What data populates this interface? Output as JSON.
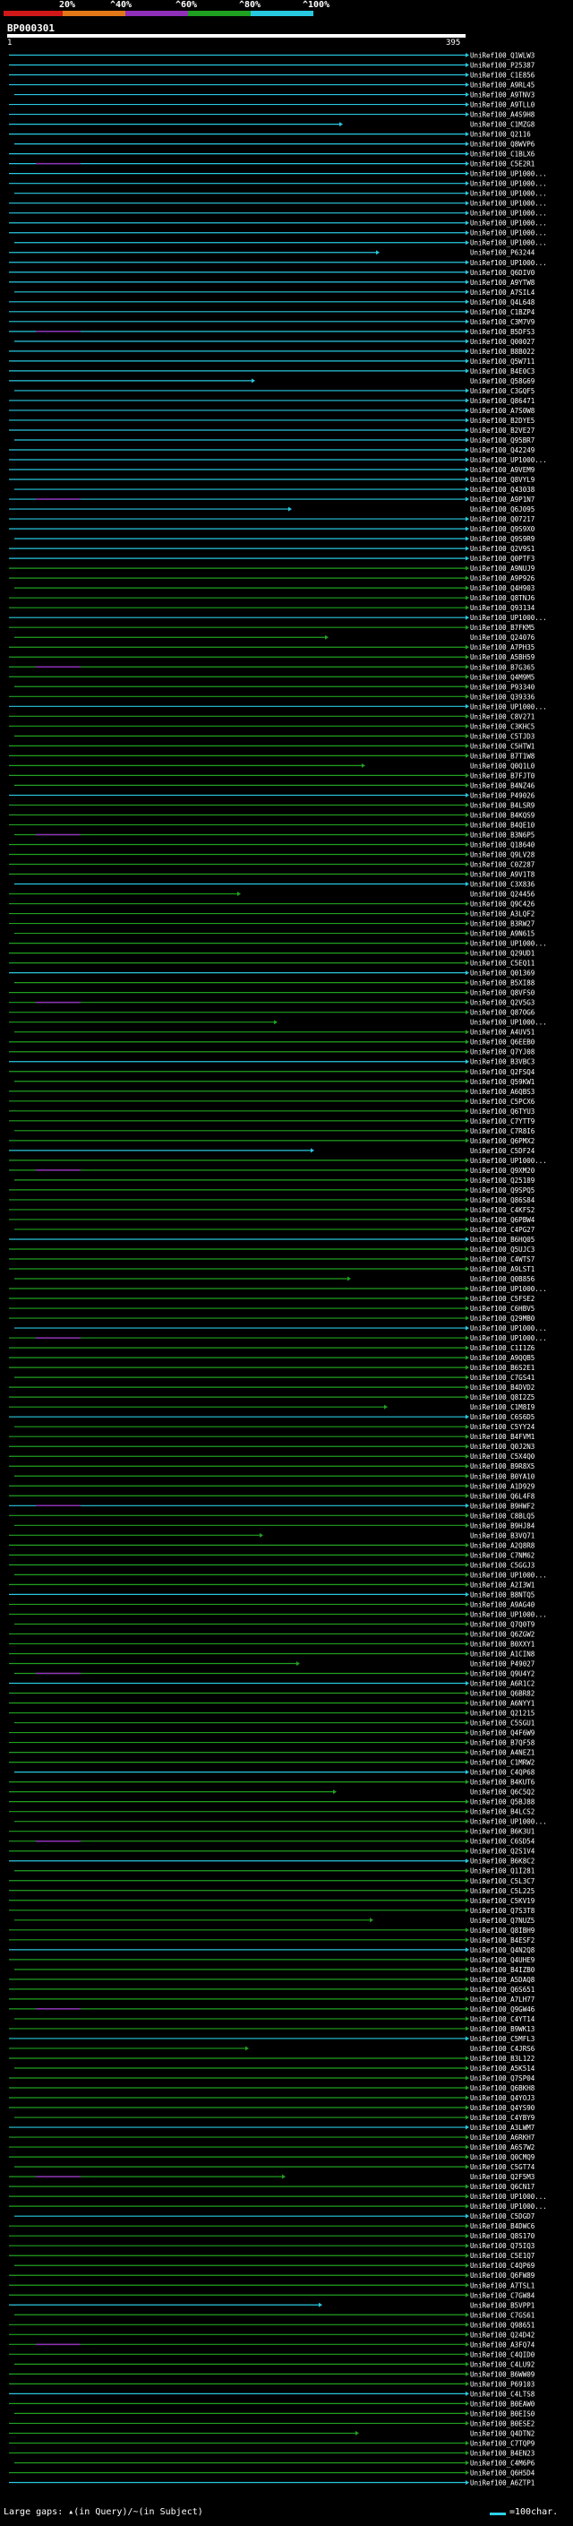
{
  "legend": {
    "labels": [
      "20%",
      "^40%",
      "^60%",
      "^80%",
      "^100%"
    ],
    "colors": [
      "#d01818",
      "#e07818",
      "#9030b8",
      "#20a020",
      "#28c8e0"
    ]
  },
  "query_id": "BP000301",
  "ruler": {
    "start": "1",
    "end": "395"
  },
  "hits": [
    "UniRef100_Q1WLW3",
    "UniRef100_P25387",
    "UniRef100_C1E856",
    "UniRef100_A9RL45",
    "UniRef100_A9TNV3",
    "UniRef100_A9TLL0",
    "UniRef100_A4S9H8",
    "UniRef100_C1MZG8",
    "UniRef100_Q2116",
    "UniRef100_Q8WVP6",
    "UniRef100_C1BLX6",
    "UniRef100_C5E2R1",
    "UniRef100_UP1000...",
    "UniRef100_UP1000...",
    "UniRef100_UP1000...",
    "UniRef100_UP1000...",
    "UniRef100_UP1000...",
    "UniRef100_UP1000...",
    "UniRef100_UP1000...",
    "UniRef100_UP1000...",
    "UniRef100_P63244",
    "UniRef100_UP1000...",
    "UniRef100_Q6DIV0",
    "UniRef100_A9YTW8",
    "UniRef100_A7SIL4",
    "UniRef100_Q4L648",
    "UniRef100_C1BZP4",
    "UniRef100_C3M7V9",
    "UniRef100_B5DFS3",
    "UniRef100_Q00027",
    "UniRef100_B8B022",
    "UniRef100_Q5W711",
    "UniRef100_B4E0C3",
    "UniRef100_Q58G69",
    "UniRef100_C3GQF5",
    "UniRef100_Q86471",
    "UniRef100_A7S0W8",
    "UniRef100_B2DYE5",
    "UniRef100_B2VE27",
    "UniRef100_Q95BR7",
    "UniRef100_Q42249",
    "UniRef100_UP1000...",
    "UniRef100_A9VEM9",
    "UniRef100_Q8VYL9",
    "UniRef100_Q43038",
    "UniRef100_A9P1N7",
    "UniRef100_Q6J095",
    "UniRef100_Q07217",
    "UniRef100_Q9S9X0",
    "UniRef100_Q9S9R9",
    "UniRef100_Q2V9S1",
    "UniRef100_Q0PTF3",
    "UniRef100_A9NUJ9",
    "UniRef100_A9P926",
    "UniRef100_Q4H903",
    "UniRef100_Q8TNJ6",
    "UniRef100_Q93134",
    "UniRef100_UP1000...",
    "UniRef100_B7FKM5",
    "UniRef100_Q24076",
    "UniRef100_A7PH35",
    "UniRef100_A5BH59",
    "UniRef100_B7G365",
    "UniRef100_Q4M9M5",
    "UniRef100_P93340",
    "UniRef100_Q39336",
    "UniRef100_UP1000...",
    "UniRef100_C8V271",
    "UniRef100_C3KHC5",
    "UniRef100_C5TJD3",
    "UniRef100_C5HTW1",
    "UniRef100_B7T1W8",
    "UniRef100_Q0Q1L0",
    "UniRef100_B7FJT0",
    "UniRef100_B4NZ46",
    "UniRef100_P49026",
    "UniRef100_B4LSR9",
    "UniRef100_B4KQS9",
    "UniRef100_B4QE10",
    "UniRef100_B3N6P5",
    "UniRef100_Q18640",
    "UniRef100_Q9LV28",
    "UniRef100_C0Z287",
    "UniRef100_A9V1T8",
    "UniRef100_C3X836",
    "UniRef100_Q24456",
    "UniRef100_Q9C426",
    "UniRef100_A3LQF2",
    "UniRef100_B3RW27",
    "UniRef100_A9N615",
    "UniRef100_UP1000...",
    "UniRef100_Q29UD1",
    "UniRef100_C5EQ11",
    "UniRef100_Q01369",
    "UniRef100_B5XI88",
    "UniRef100_Q8VFS0",
    "UniRef100_Q2V5G3",
    "UniRef100_Q87OG6",
    "UniRef100_UP1000...",
    "UniRef100_A4UV51",
    "UniRef100_Q6EEB0",
    "UniRef100_Q7YJ08",
    "UniRef100_B3VBC3",
    "UniRef100_Q2FSQ4",
    "UniRef100_Q59KW1",
    "UniRef100_A6QBS3",
    "UniRef100_C5PCX6",
    "UniRef100_Q6TYU3",
    "UniRef100_C7YTT9",
    "UniRef100_C7R8I6",
    "UniRef100_Q6PMX2",
    "UniRef100_C5DF24",
    "UniRef100_UP1000...",
    "UniRef100_Q9XM20",
    "UniRef100_Q25189",
    "UniRef100_Q9SPQ5",
    "UniRef100_Q86S84",
    "UniRef100_C4KFS2",
    "UniRef100_Q6PBW4",
    "UniRef100_C4PG27",
    "UniRef100_B6HQ05",
    "UniRef100_Q5UJC3",
    "UniRef100_C4WTS7",
    "UniRef100_A9LST1",
    "UniRef100_Q0B856",
    "UniRef100_UP1000...",
    "UniRef100_C5FSE2",
    "UniRef100_C6HBV5",
    "UniRef100_Q29MB0",
    "UniRef100_UP1000...",
    "UniRef100_UP1000...",
    "UniRef100_C1I1Z6",
    "UniRef100_A9QQB5",
    "UniRef100_B6S2E1",
    "UniRef100_C7GS41",
    "UniRef100_B4DVD2",
    "UniRef100_Q8I2Z5",
    "UniRef100_C1M8I9",
    "UniRef100_C6S6D5",
    "UniRef100_C5YY24",
    "UniRef100_B4FVM1",
    "UniRef100_Q0J2N3",
    "UniRef100_C5X4Q0",
    "UniRef100_B9R8X5",
    "UniRef100_B0YA10",
    "UniRef100_A1D929",
    "UniRef100_Q6L4F8",
    "UniRef100_B9HWF2",
    "UniRef100_C8BLQ5",
    "UniRef100_B9HJ84",
    "UniRef100_B3VQ71",
    "UniRef100_A2Q8R8",
    "UniRef100_C7NM62",
    "UniRef100_C5GGJ3",
    "UniRef100_UP1000...",
    "UniRef100_A2I3W1",
    "UniRef100_B8NTQ5",
    "UniRef100_A9AG40",
    "UniRef100_UP1000...",
    "UniRef100_Q7Q0T9",
    "UniRef100_Q6ZGW2",
    "UniRef100_B0XXY1",
    "UniRef100_A1CIN8",
    "UniRef100_P49027",
    "UniRef100_Q9U4Y2",
    "UniRef100_A6R1C2",
    "UniRef100_Q6BR82",
    "UniRef100_A6NYY1",
    "UniRef100_Q21215",
    "UniRef100_C5SGU1",
    "UniRef100_Q4F6W9",
    "UniRef100_B7QF58",
    "UniRef100_A4NEZ1",
    "UniRef100_C1MRW2",
    "UniRef100_C4QP68",
    "UniRef100_B4KUT6",
    "UniRef100_Q6C5Q2",
    "UniRef100_Q5BJ88",
    "UniRef100_B4LCS2",
    "UniRef100_UP1000...",
    "UniRef100_B6K3U1",
    "UniRef100_C6SD54",
    "UniRef100_Q2S1V4",
    "UniRef100_B6K8C2",
    "UniRef100_Q1I281",
    "UniRef100_C5L3C7",
    "UniRef100_C5L225",
    "UniRef100_C5KV19",
    "UniRef100_Q7S3T8",
    "UniRef100_Q7NUZ5",
    "UniRef100_Q8IBH9",
    "UniRef100_B4ESF2",
    "UniRef100_Q4N2Q8",
    "UniRef100_Q4UHE9",
    "UniRef100_B4IZB0",
    "UniRef100_A5DAQ8",
    "UniRef100_Q6S651",
    "UniRef100_A7LH77",
    "UniRef100_Q9GW46",
    "UniRef100_C4YT14",
    "UniRef100_B9WK13",
    "UniRef100_C5MFL3",
    "UniRef100_C4JRS6",
    "UniRef100_B3L122",
    "UniRef100_A5K514",
    "UniRef100_Q7SP04",
    "UniRef100_Q6BKH8",
    "UniRef100_Q4YOJ3",
    "UniRef100_Q4YS90",
    "UniRef100_C4YBY9",
    "UniRef100_A3LWM7",
    "UniRef100_A6RKH7",
    "UniRef100_A6S7W2",
    "UniRef100_Q0CMQ9",
    "UniRef100_C5GT74",
    "UniRef100_Q2F5M3",
    "UniRef100_Q6CN17",
    "UniRef100_UP1000...",
    "UniRef100_UP1000...",
    "UniRef100_C5DGD7",
    "UniRef100_B4DWC6",
    "UniRef100_Q8S170",
    "UniRef100_Q75IQ3",
    "UniRef100_C5E1Q7",
    "UniRef100_C4QP69",
    "UniRef100_Q6FW89",
    "UniRef100_A7TSL1",
    "UniRef100_C7GW84",
    "UniRef100_B5VPP1",
    "UniRef100_C7GS61",
    "UniRef100_Q98651",
    "UniRef100_Q24D42",
    "UniRef100_A3FQ74",
    "UniRef100_C4QID0",
    "UniRef100_C4LU92",
    "UniRef100_B6WW09",
    "UniRef100_P69103",
    "UniRef100_C4LTS8",
    "UniRef100_B0EAW0",
    "UniRef100_B0EIS0",
    "UniRef100_B0ESE2",
    "UniRef100_Q4DTN2",
    "UniRef100_C7TQP9",
    "UniRef100_B4EN23",
    "UniRef100_C4M6P6",
    "UniRef100_Q6H5D4",
    "UniRef100_A6ZTP1"
  ],
  "footer": {
    "gaps_text": "Large gaps: ▴(in Query)/~(in Subject)",
    "scale_text": "=100char."
  }
}
